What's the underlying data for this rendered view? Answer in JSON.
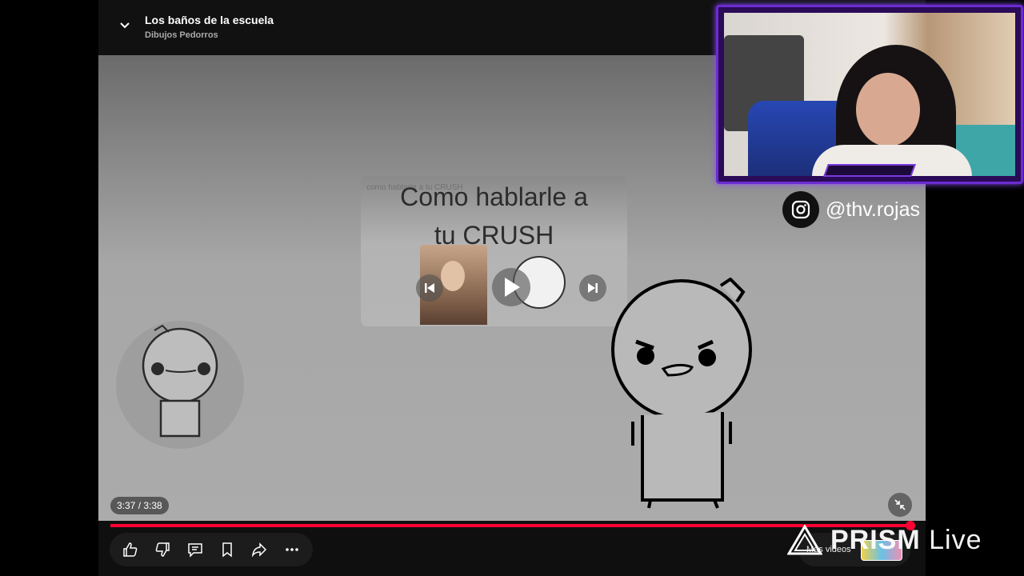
{
  "header": {
    "video_title": "Los baños de la escuela",
    "channel_name": "Dibujos Pedorros"
  },
  "endscreen": {
    "small_label": "como hablarle a tu CRUSH",
    "title_line1": "Como hablarle a",
    "title_line2": "tu CRUSH"
  },
  "player": {
    "time": "3:37 / 3:38",
    "progress": 0.995,
    "accent_color": "#ff0033"
  },
  "actions": {
    "icons": [
      "like-icon",
      "dislike-icon",
      "comment-icon",
      "save-icon",
      "share-icon",
      "more-icon"
    ]
  },
  "more_videos": {
    "label": "Más videos"
  },
  "overlay": {
    "instagram_handle": "@thv.rojas",
    "webcam_border_color": "#6b2bd1",
    "prism_brand": "PRISM",
    "prism_live": "Live"
  }
}
